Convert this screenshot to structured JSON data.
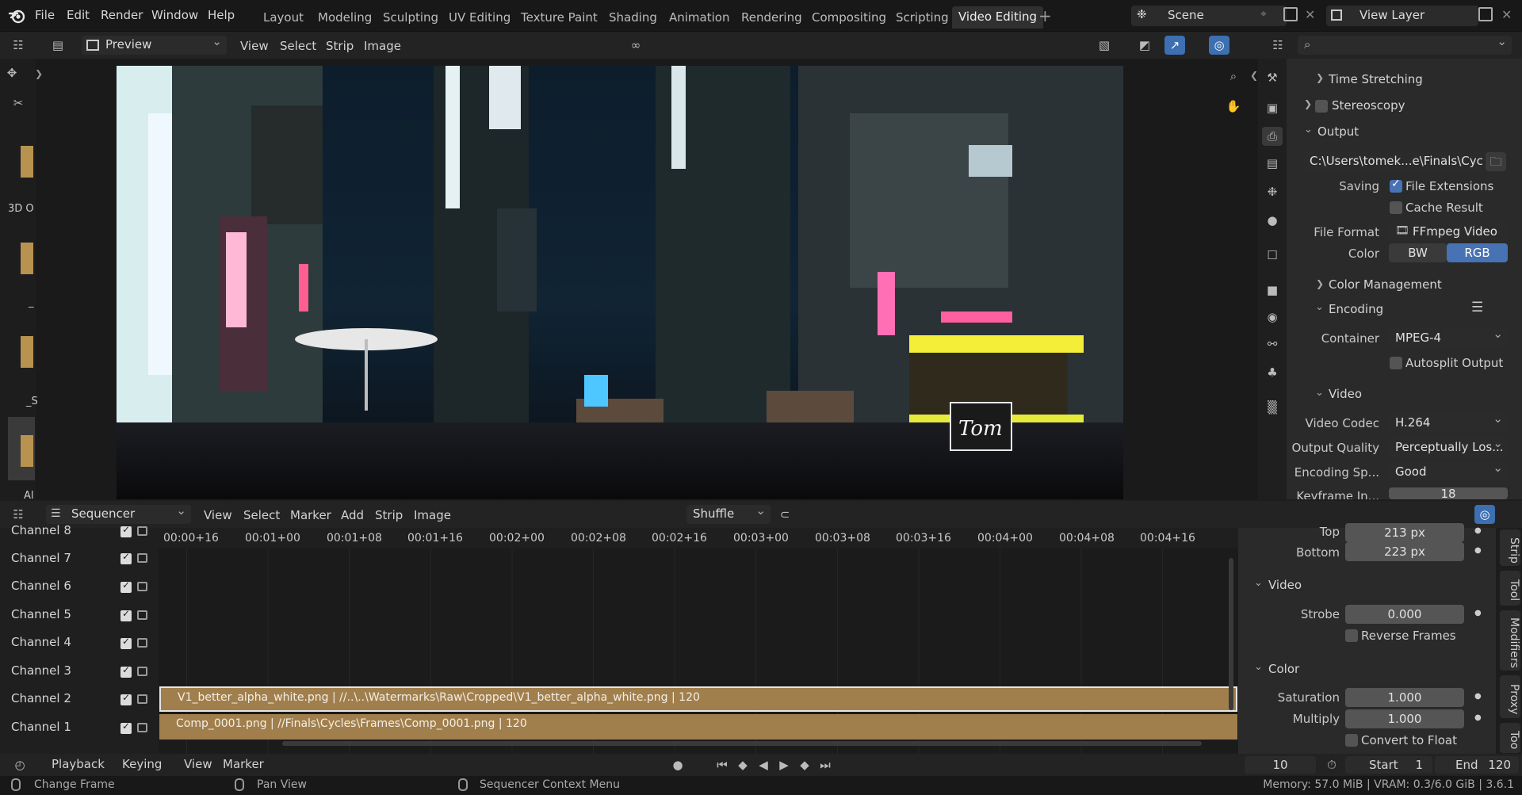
{
  "app_menu": [
    "File",
    "Edit",
    "Render",
    "Window",
    "Help"
  ],
  "workspaces": [
    "Layout",
    "Modeling",
    "Sculpting",
    "UV Editing",
    "Texture Paint",
    "Shading",
    "Animation",
    "Rendering",
    "Compositing",
    "Scripting",
    "Video Editing"
  ],
  "active_workspace": "Video Editing",
  "scene": {
    "name": "Scene",
    "view_layer": "View Layer"
  },
  "preview_header": {
    "mode": "Preview",
    "menus": [
      "View",
      "Select",
      "Strip",
      "Image"
    ]
  },
  "left_toolbar_labels": [
    "3D O",
    "_",
    "_S",
    "Al"
  ],
  "watermark_text": "Tom",
  "properties": {
    "sections": {
      "time_stretching": "Time Stretching",
      "stereoscopy": "Stereoscopy",
      "output": "Output",
      "color_management": "Color Management",
      "encoding": "Encoding",
      "video": "Video"
    },
    "output_path": "C:\\Users\\tomek...e\\Finals\\Cycles\\",
    "saving_label": "Saving",
    "file_extensions": "File Extensions",
    "cache_result": "Cache Result",
    "file_format_label": "File Format",
    "file_format": "FFmpeg Video",
    "color_label": "Color",
    "color_bw": "BW",
    "color_rgb": "RGB",
    "container_label": "Container",
    "container": "MPEG-4",
    "autosplit": "Autosplit Output",
    "video_codec_label": "Video Codec",
    "video_codec": "H.264",
    "output_quality_label": "Output Quality",
    "output_quality": "Perceptually Los...",
    "encoding_speed_label": "Encoding Sp...",
    "encoding_speed": "Good",
    "keyframe_label": "Keyframe In...",
    "keyframe": "18"
  },
  "sequencer_header": {
    "mode": "Sequencer",
    "menus": [
      "View",
      "Select",
      "Marker",
      "Add",
      "Strip",
      "Image"
    ],
    "overlap_mode": "Shuffle"
  },
  "channels": [
    "Channel 8",
    "Channel 7",
    "Channel 6",
    "Channel 5",
    "Channel 4",
    "Channel 3",
    "Channel 2",
    "Channel 1"
  ],
  "time_ticks": [
    "00:00+16",
    "00:01+00",
    "00:01+08",
    "00:01+16",
    "00:02+00",
    "00:02+08",
    "00:02+16",
    "00:03+00",
    "00:03+08",
    "00:03+16",
    "00:04+00",
    "00:04+08",
    "00:04+16"
  ],
  "strips": {
    "ch2": "V1_better_alpha_white.png | //..\\..\\Watermarks\\Raw\\Cropped\\V1_better_alpha_white.png | 120",
    "ch1": "Comp_0001.png | //Finals\\Cycles\\Frames\\Comp_0001.png | 120"
  },
  "strip_props": {
    "top_label": "Top",
    "top": "213 px",
    "bottom_label": "Bottom",
    "bottom": "223 px",
    "video_section": "Video",
    "strobe_label": "Strobe",
    "strobe": "0.000",
    "reverse_frames": "Reverse Frames",
    "color_section": "Color",
    "saturation_label": "Saturation",
    "saturation": "1.000",
    "multiply_label": "Multiply",
    "multiply": "1.000",
    "convert_float": "Convert to Float"
  },
  "side_tabs": [
    "Strip",
    "Tool",
    "Modifiers",
    "Proxy",
    "Too"
  ],
  "timeline": {
    "menus": [
      "Playback",
      "Keying",
      "View",
      "Marker"
    ],
    "current_frame": "10",
    "start_label": "Start",
    "start": "1",
    "end_label": "End",
    "end": "120"
  },
  "status_bar": {
    "change_frame": "Change Frame",
    "pan_view": "Pan View",
    "context_menu": "Sequencer Context Menu",
    "memory": "Memory: 57.0 MiB | VRAM: 0.3/6.0 GiB | 3.6.1"
  }
}
